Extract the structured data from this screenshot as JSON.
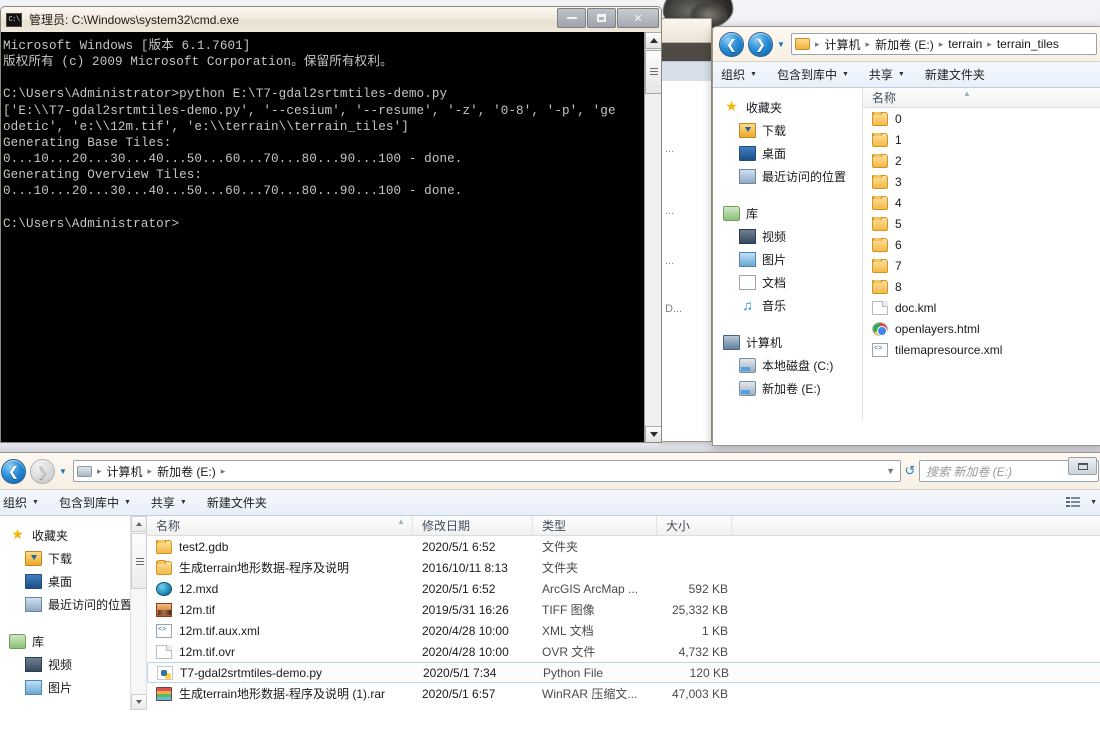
{
  "cmd_window": {
    "title": "管理员: C:\\Windows\\system32\\cmd.exe",
    "icon_label": "C:\\",
    "buttons": {
      "minimize": "–",
      "maximize": "□",
      "close": "✕"
    },
    "console_text": "Microsoft Windows [版本 6.1.7601]\n版权所有 (c) 2009 Microsoft Corporation。保留所有权利。\n\nC:\\Users\\Administrator>python E:\\T7-gdal2srtmtiles-demo.py\n['E:\\\\T7-gdal2srtmtiles-demo.py', '--cesium', '--resume', '-z', '0-8', '-p', 'ge\nodetic', 'e:\\\\12m.tif', 'e:\\\\terrain\\\\terrain_tiles']\nGenerating Base Tiles:\n0...10...20...30...40...50...60...70...80...90...100 - done.\nGenerating Overview Tiles:\n0...10...20...30...40...50...60...70...80...90...100 - done.\n\nC:\\Users\\Administrator>"
  },
  "background_window": {
    "fragments": [
      "...",
      "...",
      "...",
      "D..."
    ]
  },
  "explorer_right": {
    "breadcrumbs": [
      "计算机",
      "新加卷 (E:)",
      "terrain",
      "terrain_tiles"
    ],
    "toolbar": {
      "organize": "组织",
      "include_in_library": "包含到库中",
      "share": "共享",
      "new_folder": "新建文件夹"
    },
    "nav_pane": {
      "groups": [
        {
          "label": "收藏夹",
          "icon": "star-icon",
          "items": [
            {
              "label": "下载",
              "icon": "downloads-icon"
            },
            {
              "label": "桌面",
              "icon": "desktop-icon"
            },
            {
              "label": "最近访问的位置",
              "icon": "recent-places-icon"
            }
          ]
        },
        {
          "label": "库",
          "icon": "library-icon",
          "items": [
            {
              "label": "视频",
              "icon": "video-icon"
            },
            {
              "label": "图片",
              "icon": "pictures-icon"
            },
            {
              "label": "文档",
              "icon": "documents-icon"
            },
            {
              "label": "音乐",
              "icon": "music-icon"
            }
          ]
        },
        {
          "label": "计算机",
          "icon": "computer-icon",
          "items": [
            {
              "label": "本地磁盘 (C:)",
              "icon": "hard-disk-icon"
            },
            {
              "label": "新加卷 (E:)",
              "icon": "hard-disk-icon"
            }
          ]
        }
      ]
    },
    "column_header": {
      "name": "名称"
    },
    "files": [
      {
        "name": "0",
        "icon": "folder-icon"
      },
      {
        "name": "1",
        "icon": "folder-icon"
      },
      {
        "name": "2",
        "icon": "folder-icon"
      },
      {
        "name": "3",
        "icon": "folder-icon"
      },
      {
        "name": "4",
        "icon": "folder-icon"
      },
      {
        "name": "5",
        "icon": "folder-icon"
      },
      {
        "name": "6",
        "icon": "folder-icon"
      },
      {
        "name": "7",
        "icon": "folder-icon"
      },
      {
        "name": "8",
        "icon": "folder-icon"
      },
      {
        "name": "doc.kml",
        "icon": "generic-file-icon"
      },
      {
        "name": "openlayers.html",
        "icon": "chrome-html-icon"
      },
      {
        "name": "tilemapresource.xml",
        "icon": "xml-file-icon"
      }
    ]
  },
  "explorer_bottom": {
    "breadcrumbs": [
      "计算机",
      "新加卷 (E:)"
    ],
    "search": {
      "placeholder": "搜索 新加卷 (E:)"
    },
    "toolbar": {
      "organize": "组织",
      "include_in_library": "包含到库中",
      "share": "共享",
      "new_folder": "新建文件夹"
    },
    "nav_pane": {
      "groups": [
        {
          "label": "收藏夹",
          "icon": "star-icon",
          "items": [
            {
              "label": "下载",
              "icon": "downloads-icon"
            },
            {
              "label": "桌面",
              "icon": "desktop-icon"
            },
            {
              "label": "最近访问的位置",
              "icon": "recent-places-icon"
            }
          ]
        },
        {
          "label": "库",
          "icon": "library-icon",
          "items": [
            {
              "label": "视频",
              "icon": "video-icon"
            },
            {
              "label": "图片",
              "icon": "pictures-icon"
            }
          ]
        }
      ]
    },
    "columns": [
      "名称",
      "修改日期",
      "类型",
      "大小"
    ],
    "files": [
      {
        "name": "test2.gdb",
        "modified": "2020/5/1 6:52",
        "type": "文件夹",
        "size": "",
        "icon": "folder-icon",
        "selected": false
      },
      {
        "name": "生成terrain地形数据-程序及说明",
        "modified": "2016/10/11 8:13",
        "type": "文件夹",
        "size": "",
        "icon": "folder-icon",
        "selected": false
      },
      {
        "name": "12.mxd",
        "modified": "2020/5/1 6:52",
        "type": "ArcGIS ArcMap ...",
        "size": "592 KB",
        "icon": "mxd-file-icon",
        "selected": false
      },
      {
        "name": "12m.tif",
        "modified": "2019/5/31 16:26",
        "type": "TIFF 图像",
        "size": "25,332 KB",
        "icon": "tiff-image-icon",
        "selected": false
      },
      {
        "name": "12m.tif.aux.xml",
        "modified": "2020/4/28 10:00",
        "type": "XML 文档",
        "size": "1 KB",
        "icon": "xml-file-icon",
        "selected": false
      },
      {
        "name": "12m.tif.ovr",
        "modified": "2020/4/28 10:00",
        "type": "OVR 文件",
        "size": "4,732 KB",
        "icon": "generic-file-icon",
        "selected": false
      },
      {
        "name": "T7-gdal2srtmtiles-demo.py",
        "modified": "2020/5/1 7:34",
        "type": "Python File",
        "size": "120 KB",
        "icon": "python-file-icon",
        "selected": true
      },
      {
        "name": "生成terrain地形数据-程序及说明 (1).rar",
        "modified": "2020/5/1 6:57",
        "type": "WinRAR 压缩文...",
        "size": "47,003 KB",
        "icon": "winrar-file-icon",
        "selected": false
      }
    ]
  }
}
